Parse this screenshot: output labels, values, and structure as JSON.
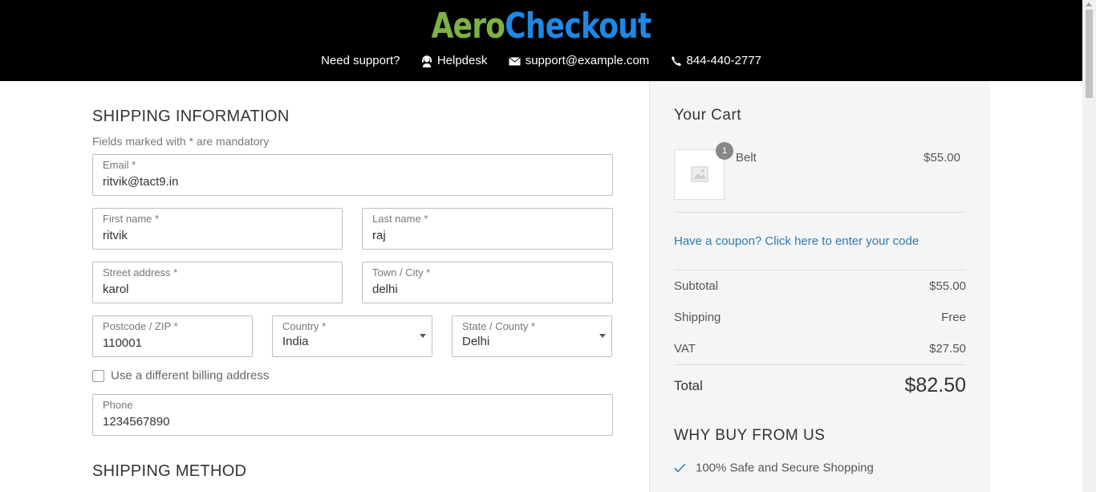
{
  "header": {
    "logo_part1": "Aero",
    "logo_part2": "Checkout",
    "need_support": "Need support?",
    "helpdesk": "Helpdesk",
    "email": "support@example.com",
    "phone": "844-440-2777",
    "colors": {
      "logo_green": "#7cb342",
      "logo_blue": "#1e88e5",
      "bg": "#000000"
    }
  },
  "shipping": {
    "title": "SHIPPING INFORMATION",
    "mandatory_note": "Fields marked with * are mandatory",
    "fields": {
      "email": {
        "label": "Email *",
        "value": "ritvik@tact9.in"
      },
      "first_name": {
        "label": "First name *",
        "value": "ritvik"
      },
      "last_name": {
        "label": "Last name *",
        "value": "raj"
      },
      "street": {
        "label": "Street address *",
        "value": "karol"
      },
      "town": {
        "label": "Town / City *",
        "value": "delhi"
      },
      "postcode": {
        "label": "Postcode / ZIP *",
        "value": "110001"
      },
      "country": {
        "label": "Country *",
        "value": "India"
      },
      "state": {
        "label": "State / County *",
        "value": "Delhi"
      },
      "phone": {
        "label": "Phone",
        "value": "1234567890"
      }
    },
    "billing_checkbox": "Use a different billing address",
    "method_title": "SHIPPING METHOD"
  },
  "cart": {
    "title": "Your Cart",
    "item": {
      "name": "Belt",
      "price": "$55.00",
      "qty": "1",
      "thumb_icon": "image-placeholder-icon"
    },
    "coupon": "Have a coupon? Click here to enter your code",
    "subtotal_label": "Subtotal",
    "subtotal": "$55.00",
    "shipping_label": "Shipping",
    "shipping": "Free",
    "vat_label": "VAT",
    "vat": "$27.50",
    "total_label": "Total",
    "total": "$82.50",
    "why_title": "WHY BUY FROM US",
    "why_items": [
      "100% Safe and Secure Shopping"
    ],
    "accent": "#2a7ab5"
  }
}
